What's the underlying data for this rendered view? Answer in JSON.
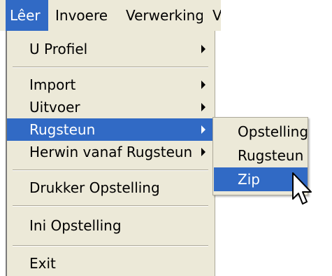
{
  "menubar": {
    "items": [
      {
        "label": "Lêer",
        "active": true
      },
      {
        "label": "Invoere"
      },
      {
        "label": "Verwerking"
      },
      {
        "label": "V"
      }
    ]
  },
  "file_menu": {
    "items": [
      {
        "label": "U Profiel",
        "submenu": true
      },
      {
        "label": "Import",
        "submenu": true
      },
      {
        "label": "Uitvoer",
        "submenu": true
      },
      {
        "label": "Rugsteun",
        "submenu": true,
        "highlighted": true
      },
      {
        "label": "Herwin vanaf Rugsteun",
        "submenu": true
      },
      {
        "label": "Drukker Opstelling"
      },
      {
        "label": "Ini Opstelling"
      },
      {
        "label": "Exit"
      }
    ]
  },
  "rugsteun_submenu": {
    "items": [
      {
        "label": "Opstelling"
      },
      {
        "label": "Rugsteun"
      },
      {
        "label": "Zip",
        "highlighted": true
      }
    ]
  },
  "colors": {
    "menu_bg": "#ece9d8",
    "highlight": "#316ac5",
    "highlight_text": "#ffffff"
  },
  "cursor": {
    "icon": "arrow-cursor-icon"
  }
}
